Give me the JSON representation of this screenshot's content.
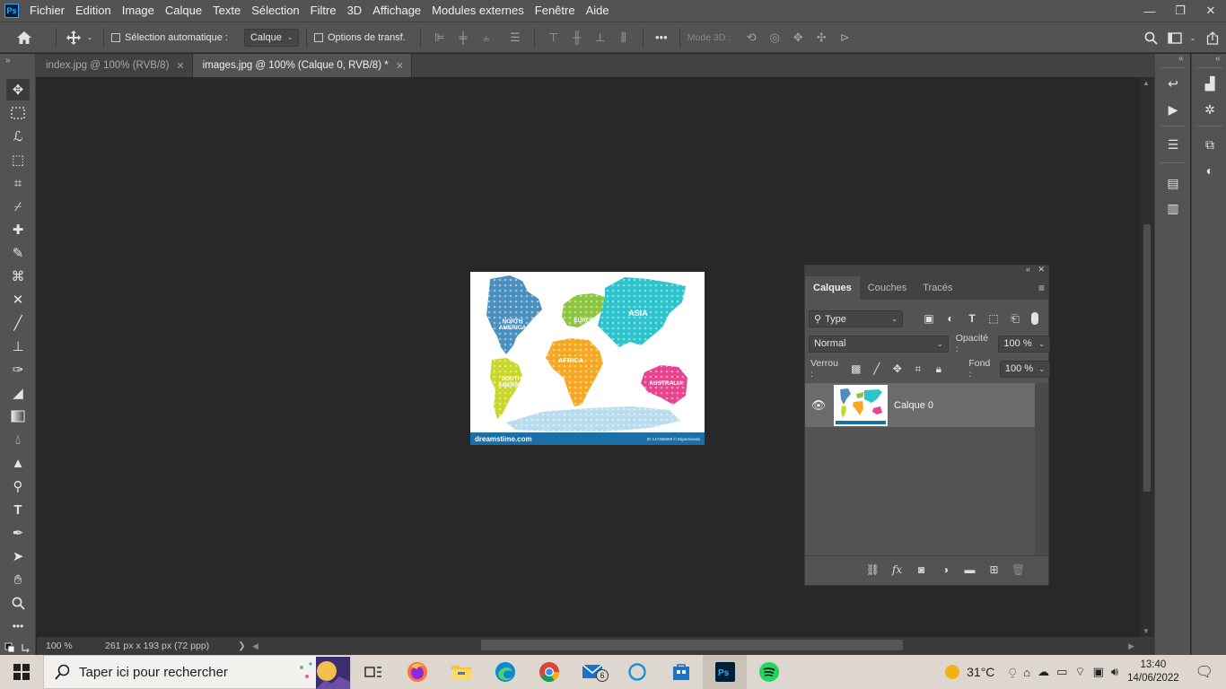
{
  "app": {
    "logo": "Ps",
    "menu": [
      "Fichier",
      "Edition",
      "Image",
      "Calque",
      "Texte",
      "Sélection",
      "Filtre",
      "3D",
      "Affichage",
      "Modules externes",
      "Fenêtre",
      "Aide"
    ],
    "window_controls": {
      "minimize": "—",
      "restore": "❐",
      "close": "✕"
    }
  },
  "options_bar": {
    "auto_select_label": "Sélection automatique :",
    "auto_select_target": "Calque",
    "transform_label": "Options de transf.",
    "more": "•••",
    "mode_3d_label": "Mode 3D :"
  },
  "tabs": [
    {
      "label": "index.jpg @ 100% (RVB/8)",
      "close": "✕",
      "active": false
    },
    {
      "label": "images.jpg @ 100% (Calque 0, RVB/8) *",
      "close": "✕",
      "active": true
    }
  ],
  "status": {
    "zoom": "100 %",
    "doc_info": "261 px x 193 px (72 ppp)",
    "arrow": "❯"
  },
  "image": {
    "continents": [
      "NORTH AMERICA",
      "EUROPE",
      "ASIA",
      "AFRICA",
      "SOUTH AMERICA",
      "AUSTRALIA"
    ],
    "footer_brand": "dreamstime.com",
    "footer_id": "ID 147358059 © Elgarmikeda",
    "continent_colors": {
      "north_america": "#4b8fbf",
      "europe": "#8cc63f",
      "asia": "#2cc3cc",
      "africa": "#f7a823",
      "south_america": "#c9d72b",
      "australia": "#e8438f",
      "antarctica": "#b9dcef"
    }
  },
  "layers_panel": {
    "tabs": [
      "Calques",
      "Couches",
      "Tracés"
    ],
    "filter_kind": "Type",
    "blend_mode": "Normal",
    "opacity_label": "Opacité :",
    "opacity_value": "100 %",
    "lock_label": "Verrou :",
    "fill_label": "Fond :",
    "fill_value": "100 %",
    "layers": [
      {
        "name": "Calque 0",
        "visible": true
      }
    ]
  },
  "taskbar": {
    "search_placeholder": "Taper ici pour rechercher",
    "mail_badge": "6",
    "temperature": "31°C",
    "time": "13:40",
    "date": "14/06/2022"
  }
}
